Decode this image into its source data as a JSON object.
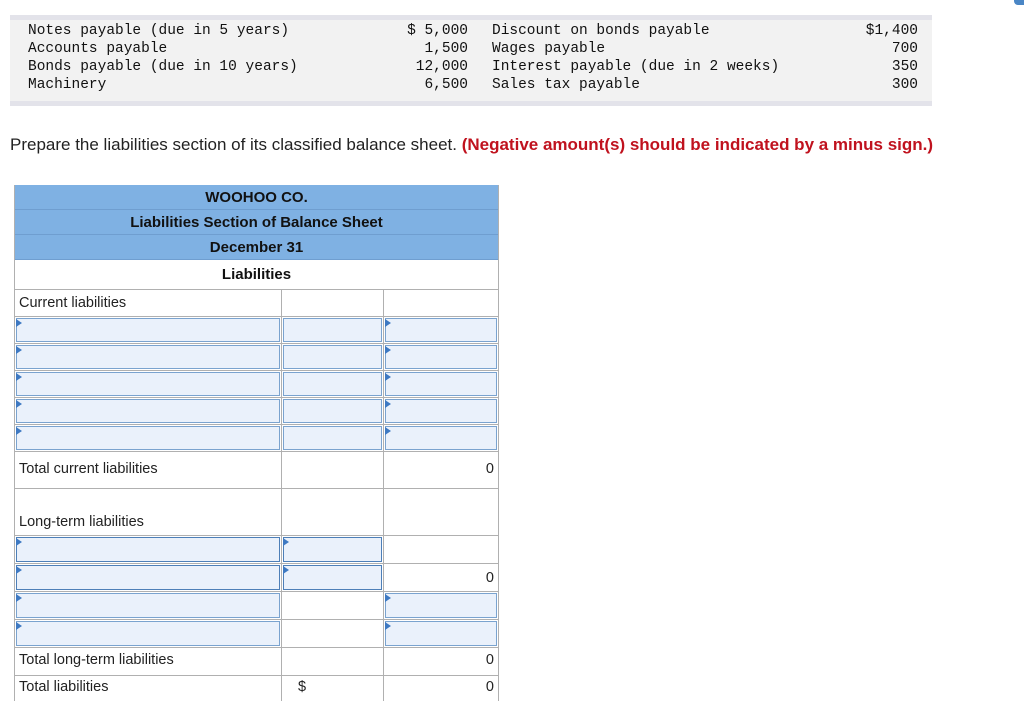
{
  "given_data": [
    {
      "label1": "Notes payable (due in 5 years)",
      "amount1": "$ 5,000",
      "label2": "Discount on bonds payable",
      "amount2": "$1,400"
    },
    {
      "label1": "Accounts payable",
      "amount1": "1,500",
      "label2": "Wages payable",
      "amount2": "700"
    },
    {
      "label1": "Bonds payable (due in 10 years)",
      "amount1": "12,000",
      "label2": "Interest payable (due in 2 weeks)",
      "amount2": "350"
    },
    {
      "label1": "Machinery",
      "amount1": "6,500",
      "label2": "Sales tax payable",
      "amount2": "300"
    }
  ],
  "instruction": {
    "text": "Prepare the liabilities section of its classified balance sheet.",
    "warning": "(Negative amount(s) should be indicated by a minus sign.)"
  },
  "sheet": {
    "company": "WOOHOO CO.",
    "title": "Liabilities Section of Balance Sheet",
    "date": "December 31",
    "section": "Liabilities",
    "current_label": "Current liabilities",
    "total_current_label": "Total current liabilities",
    "total_current_value": "0",
    "longterm_label": "Long-term liabilities",
    "longterm_subtotal_value": "0",
    "total_longterm_label": "Total long-term liabilities",
    "total_longterm_value": "0",
    "total_liabilities_label": "Total liabilities",
    "total_liabilities_dollar": "$",
    "total_liabilities_value": "0"
  },
  "colors": {
    "header_blue": "#7fb1e3",
    "warning_red": "#c0121e",
    "input_fill": "#eaf1fb",
    "input_border": "#7aa3cf"
  }
}
